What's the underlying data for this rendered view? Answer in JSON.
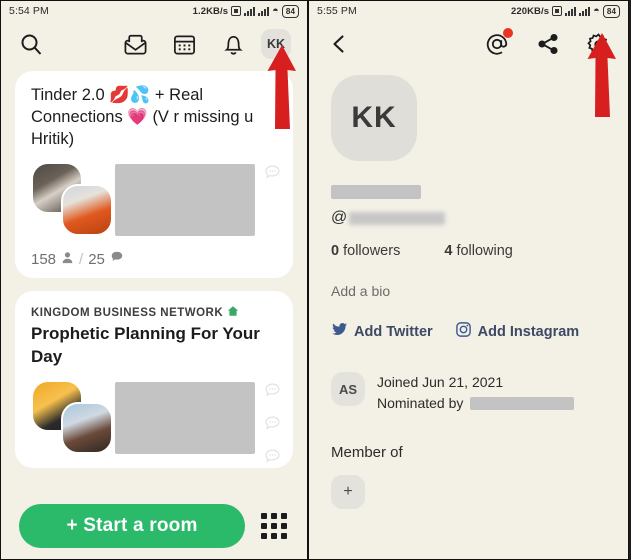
{
  "left": {
    "statusbar": {
      "time": "5:54 PM",
      "net_speed": "1.2KB/s",
      "battery": "84",
      "data_icon": "data-saver-icon",
      "signal_icon": "signal-bars-icon",
      "wifi_icon": "wifi-icon"
    },
    "header": {
      "search_icon": "search-icon",
      "mail_icon": "envelope-icon",
      "calendar_icon": "calendar-icon",
      "bell_icon": "bell-icon",
      "avatar_initials": "KK"
    },
    "feed": [
      {
        "club": "",
        "title": "Tinder 2.0 💋💦 + Real Connections 💗 (V r missing u Hritik)",
        "speakers": 158,
        "listeners": 25,
        "speaker_icon": "person-icon",
        "listener_icon": "speech-bubble-icon",
        "stats_separator": "/"
      },
      {
        "club": "KINGDOM BUSINESS NETWORK",
        "club_icon": "house-icon",
        "title": "Prophetic Planning For Your Day",
        "speakers": null,
        "listeners": null
      }
    ],
    "bottom": {
      "start_room_label": "+ Start a room",
      "start_room_color": "#2bb96a",
      "grid_icon": "grid-dots-icon"
    }
  },
  "right": {
    "statusbar": {
      "time": "5:55 PM",
      "net_speed": "220KB/s",
      "battery": "84"
    },
    "header": {
      "back_icon": "back-chevron-icon",
      "mentions_icon": "at-sign-icon",
      "mentions_badge": true,
      "share_icon": "share-icon",
      "settings_icon": "gear-icon"
    },
    "profile": {
      "avatar_initials": "KK",
      "name_redacted": true,
      "handle_prefix": "@",
      "handle_redacted": true,
      "followers_count": "0",
      "followers_label": "followers",
      "following_count": "4",
      "following_label": "following",
      "bio_link": "Add a bio",
      "twitter_link": "Add Twitter",
      "twitter_icon": "twitter-icon",
      "instagram_link": "Add Instagram",
      "instagram_icon": "instagram-icon",
      "nominator_initials": "AS",
      "joined_text": "Joined Jun 21, 2021",
      "nominated_label": "Nominated by",
      "nominated_redacted": true,
      "member_of_label": "Member of",
      "add_club_label": "+"
    }
  },
  "annotations": {
    "arrow_color": "#d81f1f",
    "left_arrow": "points-to-profile-avatar",
    "right_arrow": "points-to-settings-gear"
  }
}
